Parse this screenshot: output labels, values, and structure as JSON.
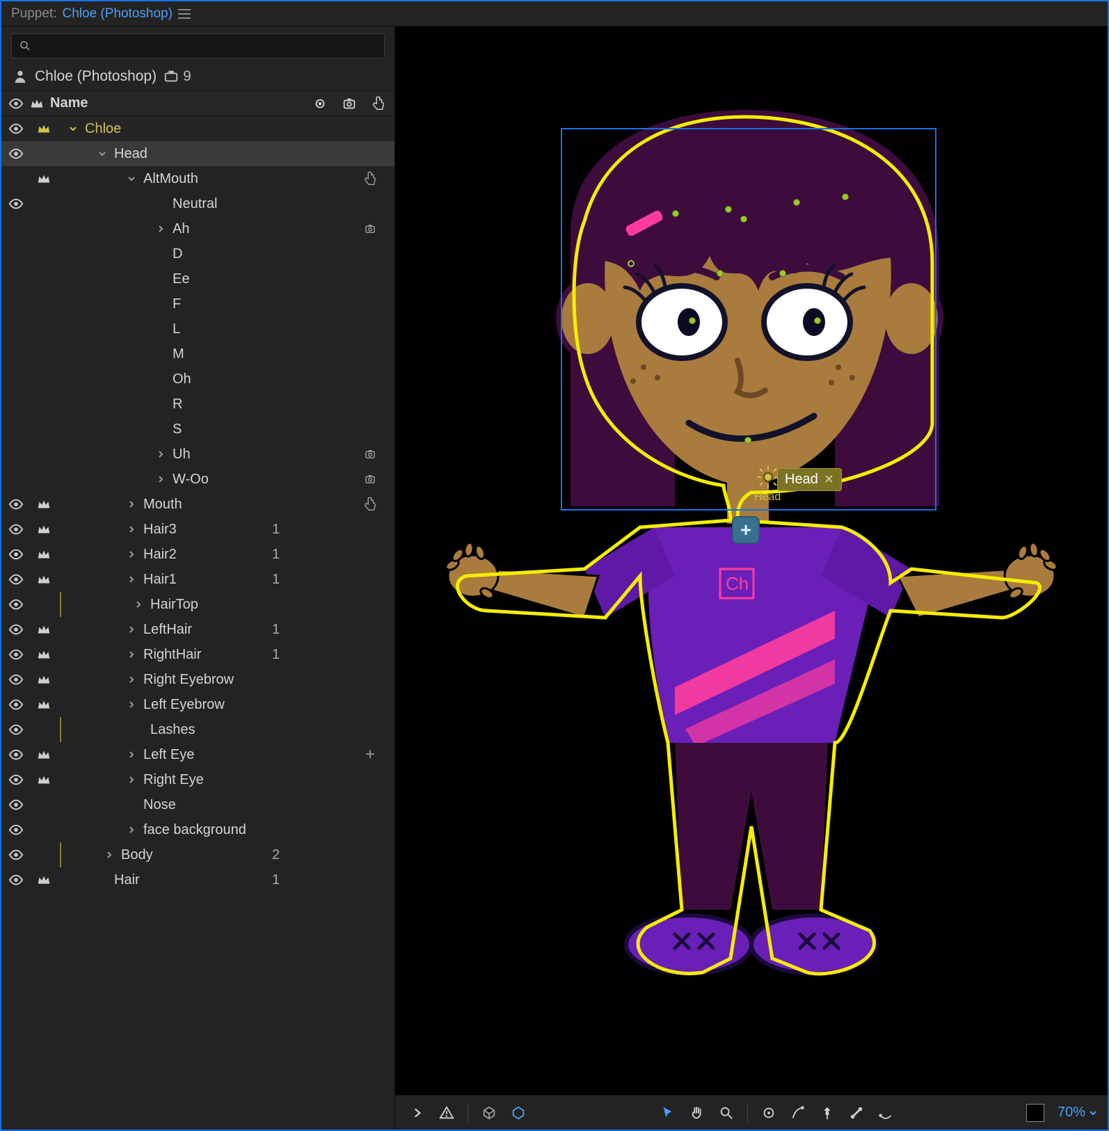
{
  "titlebar": {
    "prefix": "Puppet: ",
    "docName": "Chloe (Photoshop)"
  },
  "puppetHeader": {
    "name": "Chloe (Photoshop)",
    "count": "9"
  },
  "colHeader": {
    "label": "Name"
  },
  "tree": [
    {
      "id": "chloe",
      "label": "Chloe",
      "depth": 0,
      "expand": "down",
      "vis": true,
      "crown": true,
      "gold": true,
      "root": true
    },
    {
      "id": "head",
      "label": "Head",
      "depth": 1,
      "expand": "down",
      "vis": true,
      "selected": true
    },
    {
      "id": "altmouth",
      "label": "AltMouth",
      "depth": 2,
      "expand": "down",
      "crown": true,
      "rightIcon": "touch"
    },
    {
      "id": "neutral",
      "label": "Neutral",
      "depth": 3,
      "vis": true
    },
    {
      "id": "ah",
      "label": "Ah",
      "depth": 3,
      "expand": "right",
      "rightIcon": "gear"
    },
    {
      "id": "d",
      "label": "D",
      "depth": 3
    },
    {
      "id": "ee",
      "label": "Ee",
      "depth": 3
    },
    {
      "id": "f",
      "label": "F",
      "depth": 3
    },
    {
      "id": "l",
      "label": "L",
      "depth": 3
    },
    {
      "id": "m",
      "label": "M",
      "depth": 3
    },
    {
      "id": "oh",
      "label": "Oh",
      "depth": 3
    },
    {
      "id": "r",
      "label": "R",
      "depth": 3
    },
    {
      "id": "s",
      "label": "S",
      "depth": 3
    },
    {
      "id": "uh",
      "label": "Uh",
      "depth": 3,
      "expand": "right",
      "rightIcon": "gear"
    },
    {
      "id": "woo",
      "label": "W-Oo",
      "depth": 3,
      "expand": "right",
      "rightIcon": "gear"
    },
    {
      "id": "mouth",
      "label": "Mouth",
      "depth": 2,
      "expand": "right",
      "vis": true,
      "crown": true,
      "rightIcon": "touch"
    },
    {
      "id": "hair3",
      "label": "Hair3",
      "depth": 2,
      "expand": "right",
      "vis": true,
      "crown": true,
      "badge": "1"
    },
    {
      "id": "hair2",
      "label": "Hair2",
      "depth": 2,
      "expand": "right",
      "vis": true,
      "crown": true,
      "badge": "1"
    },
    {
      "id": "hair1",
      "label": "Hair1",
      "depth": 2,
      "expand": "right",
      "vis": true,
      "crown": true,
      "badge": "1"
    },
    {
      "id": "hairtop",
      "label": "HairTop",
      "depth": 2,
      "expand": "right",
      "vis": true,
      "indentGold": true
    },
    {
      "id": "lefthair",
      "label": "LeftHair",
      "depth": 2,
      "expand": "right",
      "vis": true,
      "crown": true,
      "badge": "1"
    },
    {
      "id": "righthair",
      "label": "RightHair",
      "depth": 2,
      "expand": "right",
      "vis": true,
      "crown": true,
      "badge": "1"
    },
    {
      "id": "reyebrow",
      "label": "Right Eyebrow",
      "depth": 2,
      "expand": "right",
      "vis": true,
      "crown": true
    },
    {
      "id": "leyebrow",
      "label": "Left Eyebrow",
      "depth": 2,
      "expand": "right",
      "vis": true,
      "crown": true
    },
    {
      "id": "lashes",
      "label": "Lashes",
      "depth": 2,
      "vis": true,
      "indentGold": true
    },
    {
      "id": "lefteye",
      "label": "Left Eye",
      "depth": 2,
      "expand": "right",
      "vis": true,
      "crown": true,
      "rightIcon": "plus"
    },
    {
      "id": "righteye",
      "label": "Right Eye",
      "depth": 2,
      "expand": "right",
      "vis": true,
      "crown": true
    },
    {
      "id": "nose",
      "label": "Nose",
      "depth": 2,
      "vis": true
    },
    {
      "id": "facebg",
      "label": "face background",
      "depth": 2,
      "expand": "right",
      "vis": true
    },
    {
      "id": "body",
      "label": "Body",
      "depth": 1,
      "expand": "right",
      "vis": true,
      "badge": "2",
      "indentGold": true
    },
    {
      "id": "hair",
      "label": "Hair",
      "depth": 1,
      "vis": true,
      "crown": true,
      "badge": "1"
    }
  ],
  "viewport": {
    "headTag": "Head",
    "originLabel": "Head",
    "chLogo": "Ch"
  },
  "bottomBar": {
    "zoom": "70%"
  }
}
